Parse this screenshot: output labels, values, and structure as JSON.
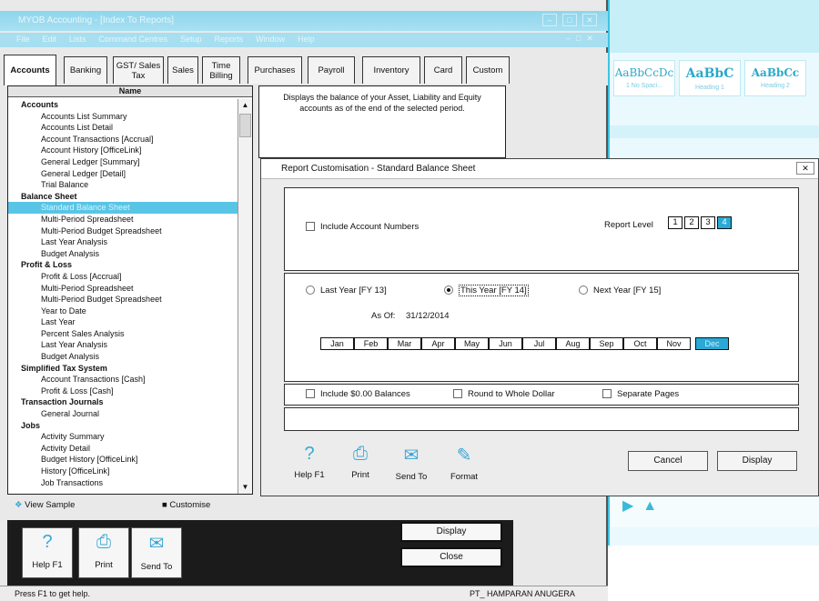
{
  "word_bg": {
    "styles": [
      {
        "sample": "AaBbCcDc",
        "name": "1 No Spaci..."
      },
      {
        "sample": "AaBbC",
        "name": "Heading 1"
      },
      {
        "sample": "AaBbCc",
        "name": "Heading 2"
      }
    ]
  },
  "window": {
    "title": "MYOB Accounting - [Index To Reports]",
    "menu": [
      "File",
      "Edit",
      "Lists",
      "Command Centres",
      "Setup",
      "Reports",
      "Window",
      "Help"
    ]
  },
  "tabs": [
    {
      "label": "Accounts",
      "active": true
    },
    {
      "label": "Banking",
      "active": false
    },
    {
      "label": "GST/ Sales Tax",
      "active": false
    },
    {
      "label": "Sales",
      "active": false
    },
    {
      "label": "Time Billing",
      "active": false
    },
    {
      "label": "Purchases",
      "active": false
    },
    {
      "label": "Payroll",
      "active": false
    },
    {
      "label": "Inventory",
      "active": false
    },
    {
      "label": "Card",
      "active": false
    },
    {
      "label": "Custom",
      "active": false
    }
  ],
  "report_list": {
    "header": "Name",
    "items": [
      {
        "label": "Accounts",
        "type": "cat"
      },
      {
        "label": "Accounts List Summary",
        "type": "sub"
      },
      {
        "label": "Accounts List Detail",
        "type": "sub"
      },
      {
        "label": "Account Transactions [Accrual]",
        "type": "sub"
      },
      {
        "label": "Account History [OfficeLink]",
        "type": "sub"
      },
      {
        "label": "General Ledger [Summary]",
        "type": "sub"
      },
      {
        "label": "General Ledger [Detail]",
        "type": "sub"
      },
      {
        "label": "Trial Balance",
        "type": "sub"
      },
      {
        "label": "Balance Sheet",
        "type": "cat"
      },
      {
        "label": "Standard Balance Sheet",
        "type": "sub",
        "selected": true
      },
      {
        "label": "Multi-Period Spreadsheet",
        "type": "sub"
      },
      {
        "label": "Multi-Period Budget Spreadsheet",
        "type": "sub"
      },
      {
        "label": "Last Year Analysis",
        "type": "sub"
      },
      {
        "label": "Budget Analysis",
        "type": "sub"
      },
      {
        "label": "Profit & Loss",
        "type": "cat"
      },
      {
        "label": "Profit & Loss [Accrual]",
        "type": "sub"
      },
      {
        "label": "Multi-Period Spreadsheet",
        "type": "sub"
      },
      {
        "label": "Multi-Period Budget Spreadsheet",
        "type": "sub"
      },
      {
        "label": "Year to Date",
        "type": "sub"
      },
      {
        "label": "Last Year",
        "type": "sub"
      },
      {
        "label": "Percent Sales Analysis",
        "type": "sub"
      },
      {
        "label": "Last Year Analysis",
        "type": "sub"
      },
      {
        "label": "Budget Analysis",
        "type": "sub"
      },
      {
        "label": "Simplified Tax System",
        "type": "cat"
      },
      {
        "label": "Account Transactions [Cash]",
        "type": "sub"
      },
      {
        "label": "Profit & Loss [Cash]",
        "type": "sub"
      },
      {
        "label": "Transaction Journals",
        "type": "cat"
      },
      {
        "label": "General Journal",
        "type": "sub"
      },
      {
        "label": "Jobs",
        "type": "cat"
      },
      {
        "label": "Activity Summary",
        "type": "sub"
      },
      {
        "label": "Activity Detail",
        "type": "sub"
      },
      {
        "label": "Budget History [OfficeLink]",
        "type": "sub"
      },
      {
        "label": "History [OfficeLink]",
        "type": "sub"
      },
      {
        "label": "Job Transactions",
        "type": "sub"
      }
    ]
  },
  "description": "Displays the balance of your Asset, Liability and Equity accounts as of the end of the selected period.",
  "view_sample": "View Sample",
  "customise": "Customise",
  "bottom_toolbar": {
    "help": "Help F1",
    "print": "Print",
    "send_to": "Send To",
    "display": "Display",
    "close": "Close"
  },
  "status": {
    "help_text": "Press F1 to get help.",
    "company": "PT_ HAMPARAN ANUGERA"
  },
  "dialog": {
    "title": "Report Customisation - Standard Balance Sheet",
    "include_account_numbers": "Include Account Numbers",
    "report_level_label": "Report Level",
    "report_levels": [
      "1",
      "2",
      "3",
      "4"
    ],
    "report_level_selected": "4",
    "period_options": [
      {
        "label": "Last Year [FY 13]",
        "selected": false
      },
      {
        "label": "This Year [FY 14]",
        "selected": true
      },
      {
        "label": "Next Year [FY 15]",
        "selected": false
      }
    ],
    "as_of_label": "As Of:",
    "as_of_value": "31/12/2014",
    "months": [
      "Jan",
      "Feb",
      "Mar",
      "Apr",
      "May",
      "Jun",
      "Jul",
      "Aug",
      "Sep",
      "Oct",
      "Nov",
      "Dec"
    ],
    "month_selected": "Dec",
    "options": [
      "Include $0.00 Balances",
      "Round to Whole Dollar",
      "Separate Pages"
    ],
    "tools": {
      "help": "Help F1",
      "print": "Print",
      "send_to": "Send To",
      "format": "Format"
    },
    "cancel": "Cancel",
    "display": "Display"
  }
}
